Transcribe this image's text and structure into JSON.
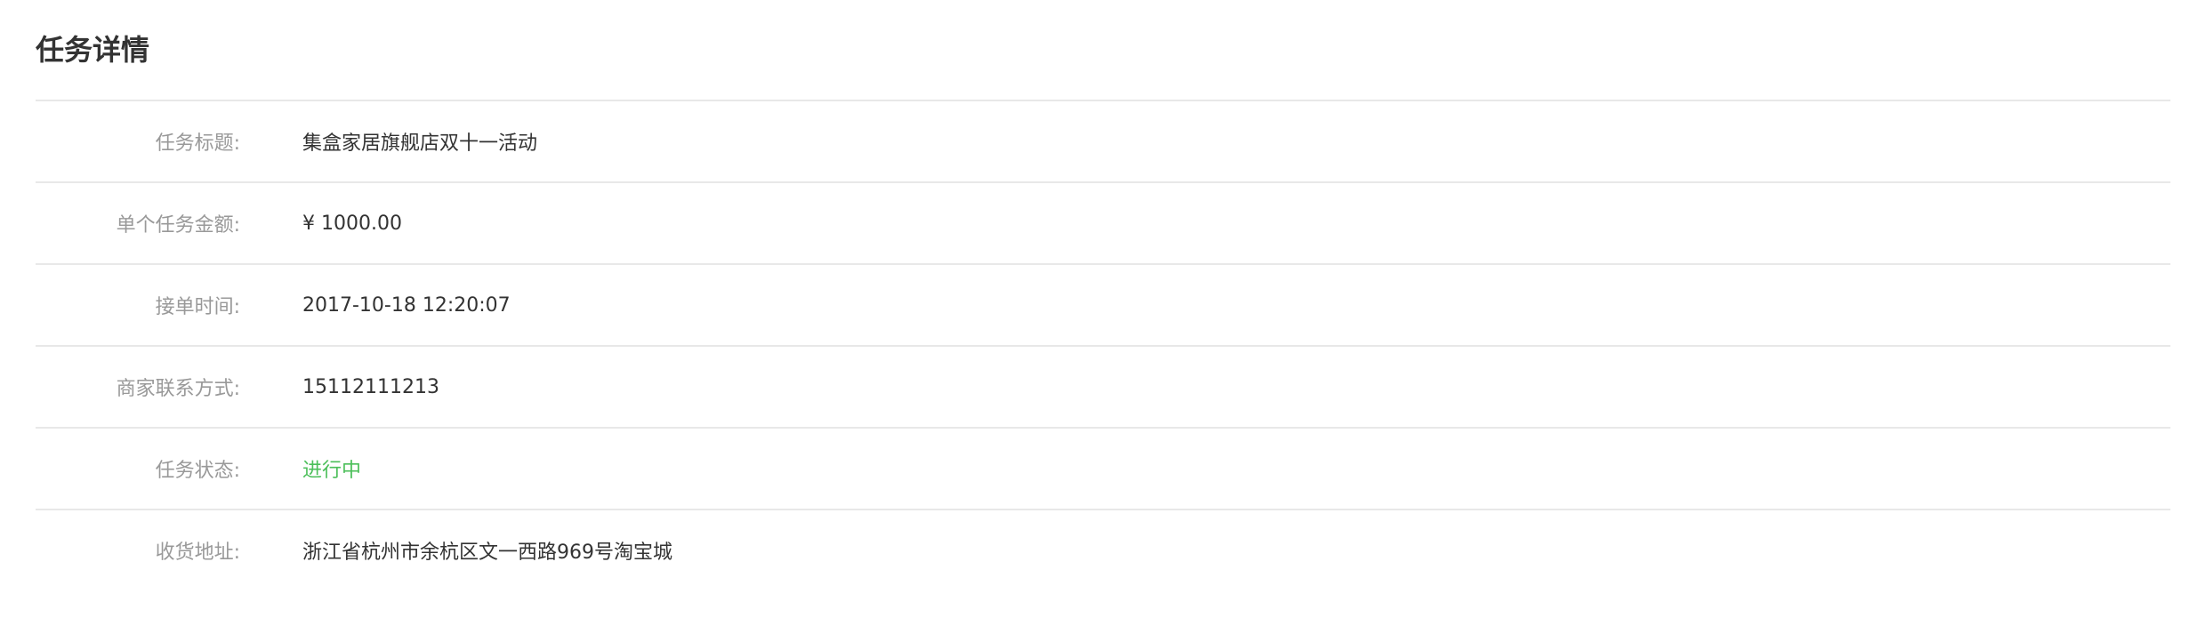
{
  "page": {
    "title": "任务详情"
  },
  "details": [
    {
      "label": "任务标题:",
      "value": "集盒家居旗舰店双十一活动"
    },
    {
      "label": "单个任务金额:",
      "value": "¥ 1000.00"
    },
    {
      "label": "接单时间:",
      "value": "2017-10-18 12:20:07"
    },
    {
      "label": "商家联系方式:",
      "value": "15112111213"
    },
    {
      "label": "任务状态:",
      "value": "进行中"
    },
    {
      "label": "收货地址:",
      "value": "浙江省杭州市余杭区文一西路969号淘宝城"
    }
  ],
  "colors": {
    "status_in_progress": "#4cbf5a",
    "label_text": "#999999",
    "value_text": "#333333",
    "divider": "#e8e8e8"
  }
}
